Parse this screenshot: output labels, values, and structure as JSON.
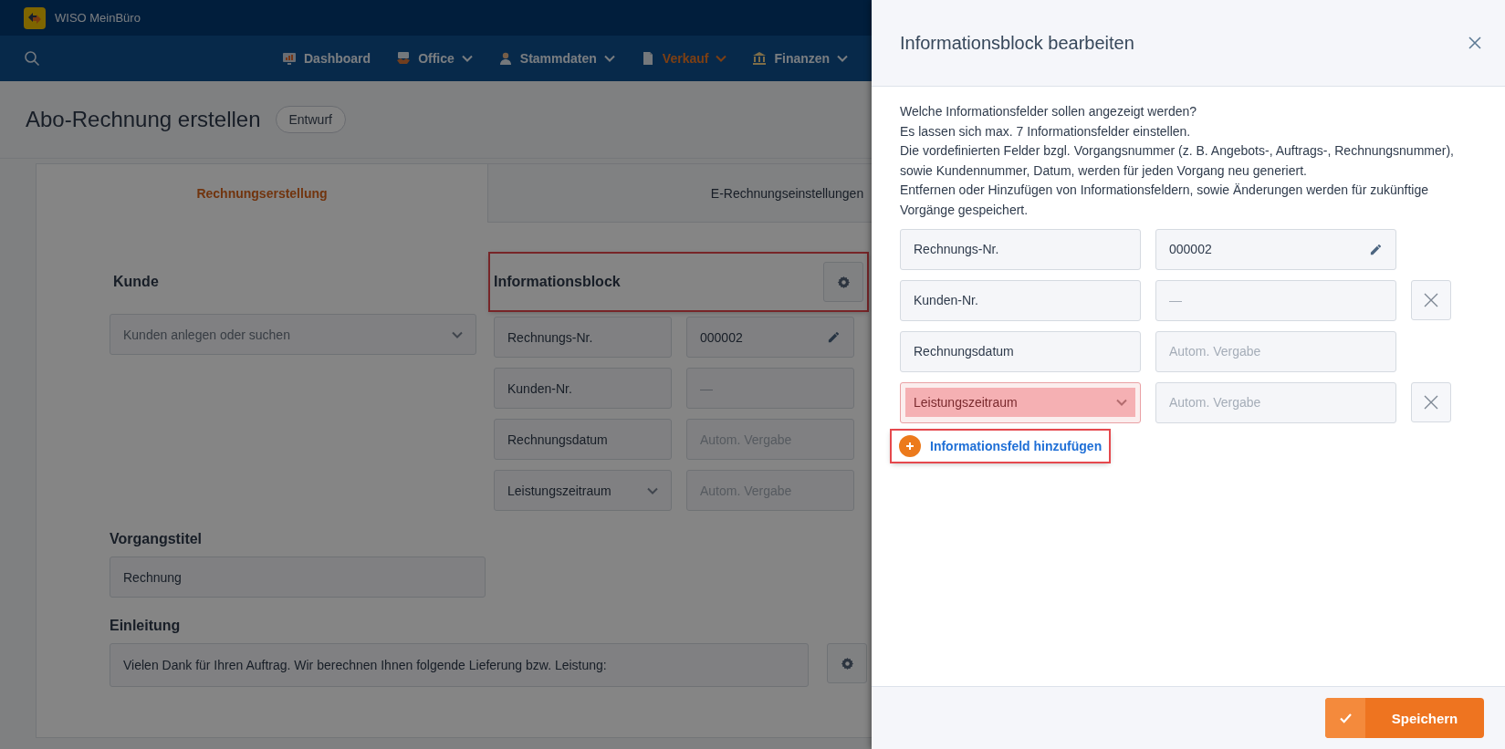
{
  "app": {
    "name": "WISO MeinBüro"
  },
  "nav": {
    "items": [
      {
        "label": "Dashboard",
        "selected": false,
        "has_menu": false
      },
      {
        "label": "Office",
        "selected": false,
        "has_menu": true
      },
      {
        "label": "Stammdaten",
        "selected": false,
        "has_menu": true
      },
      {
        "label": "Verkauf",
        "selected": true,
        "has_menu": true
      },
      {
        "label": "Finanzen",
        "selected": false,
        "has_menu": true
      }
    ]
  },
  "page": {
    "title": "Abo-Rechnung erstellen",
    "status_badge": "Entwurf"
  },
  "tabs": [
    {
      "label": "Rechnungserstellung",
      "selected": true
    },
    {
      "label": "E-Rechnungseinstellungen",
      "selected": false
    }
  ],
  "customer": {
    "heading": "Kunde",
    "placeholder": "Kunden anlegen oder suchen"
  },
  "info_block": {
    "heading": "Informationsblock",
    "highlighted": true,
    "rows": [
      {
        "kind": "text",
        "label": "Rechnungs-Nr.",
        "value": "000002",
        "editable": true
      },
      {
        "kind": "text",
        "label": "Kunden-Nr.",
        "placeholder": "—",
        "editable": false
      },
      {
        "kind": "text",
        "label": "Rechnungsdatum",
        "placeholder": "Autom. Vergabe",
        "editable": false
      },
      {
        "kind": "select",
        "label": "Leistungszeitraum",
        "placeholder": "Autom. Vergabe",
        "editable": false
      }
    ]
  },
  "title_field": {
    "heading": "Vorgangstitel",
    "value": "Rechnung"
  },
  "intro": {
    "heading": "Einleitung",
    "value": "Vielen Dank für Ihren Auftrag. Wir berechnen Ihnen folgende Lieferung bzw. Leistung:"
  },
  "panel": {
    "title": "Informationsblock bearbeiten",
    "description": [
      "Welche Informationsfelder sollen angezeigt werden?",
      "Es lassen sich max. 7 Informationsfelder einstellen.",
      "Die vordefinierten Felder bzgl. Vorgangsnummer (z. B. Angebots-, Auftrags-, Rechnungsnummer), sowie Kundennummer, Datum, werden für jeden Vorgang neu generiert.",
      "Entfernen oder Hinzufügen von Informationsfeldern, sowie Änderungen werden für zukünftige Vorgänge gespeichert."
    ],
    "rows": [
      {
        "kind": "text",
        "label": "Rechnungs-Nr.",
        "value": "000002",
        "editable": true,
        "removable": false,
        "invalid": false
      },
      {
        "kind": "text",
        "label": "Kunden-Nr.",
        "placeholder": "—",
        "editable": false,
        "removable": true,
        "invalid": false
      },
      {
        "kind": "text",
        "label": "Rechnungsdatum",
        "placeholder": "Autom. Vergabe",
        "editable": false,
        "removable": false,
        "invalid": false
      },
      {
        "kind": "select",
        "label": "Leistungszeitraum",
        "placeholder": "Autom. Vergabe",
        "editable": false,
        "removable": true,
        "invalid": true
      }
    ],
    "add_link": {
      "label": "Informationsfeld hinzufügen",
      "highlighted": true
    },
    "save_button": "Speichern"
  }
}
